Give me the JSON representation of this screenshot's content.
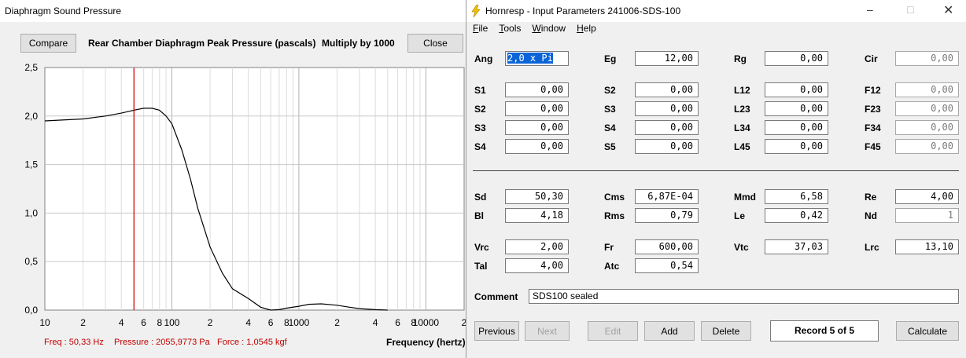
{
  "chart_window": {
    "title": "Diaphragm Sound Pressure",
    "compare_label": "Compare",
    "heading": "Rear Chamber Diaphragm Peak Pressure (pascals)",
    "multiplier": "Multiply by 1000",
    "close_label": "Close",
    "status": {
      "freq": "Freq : 50,33 Hz",
      "pressure": "Pressure : 2055,9773 Pa",
      "force": "Force : 1,0545 kgf"
    },
    "xaxis_title": "Frequency (hertz)"
  },
  "chart_data": {
    "type": "line",
    "title": "Rear Chamber Diaphragm Peak Pressure (pascals)",
    "xlabel": "Frequency (hertz)",
    "ylabel": "",
    "xscale": "log",
    "xlim": [
      10,
      20000
    ],
    "ylim": [
      0,
      2.5
    ],
    "grid": true,
    "yticks": [
      "0,0",
      "0,5",
      "1,0",
      "1,5",
      "2,0",
      "2,5"
    ],
    "xticks": [
      {
        "v": 10,
        "t": "10"
      },
      {
        "v": 20,
        "t": "2"
      },
      {
        "v": 40,
        "t": "4"
      },
      {
        "v": 60,
        "t": "6"
      },
      {
        "v": 80,
        "t": "8"
      },
      {
        "v": 100,
        "t": "100"
      },
      {
        "v": 200,
        "t": "2"
      },
      {
        "v": 400,
        "t": "4"
      },
      {
        "v": 600,
        "t": "6"
      },
      {
        "v": 800,
        "t": "8"
      },
      {
        "v": 1000,
        "t": "1000"
      },
      {
        "v": 2000,
        "t": "2"
      },
      {
        "v": 4000,
        "t": "4"
      },
      {
        "v": 6000,
        "t": "6"
      },
      {
        "v": 8000,
        "t": "8"
      },
      {
        "v": 10000,
        "t": "10000"
      },
      {
        "v": 20000,
        "t": "2"
      }
    ],
    "cursor_x": 50.33,
    "cursor_color": "#d00000",
    "series": [
      {
        "x": [
          10,
          20,
          30,
          40,
          50,
          60,
          70,
          80,
          90,
          100,
          120,
          140,
          160,
          200,
          250,
          300,
          400,
          500,
          600,
          700,
          800,
          1000,
          1200,
          1500,
          2000,
          2500,
          3000,
          4000,
          5000
        ],
        "y": [
          1.95,
          1.97,
          2.0,
          2.03,
          2.06,
          2.08,
          2.08,
          2.06,
          2.0,
          1.92,
          1.65,
          1.35,
          1.05,
          0.65,
          0.38,
          0.22,
          0.12,
          0.03,
          0.0,
          0.005,
          0.02,
          0.04,
          0.06,
          0.065,
          0.05,
          0.03,
          0.015,
          0.005,
          0.0
        ]
      }
    ]
  },
  "input_window": {
    "title": "Hornresp - Input Parameters   241006-SDS-100",
    "menu": [
      "File",
      "Tools",
      "Window",
      "Help"
    ],
    "params": [
      {
        "label": "Ang",
        "value": "2,0 x Pi"
      },
      {
        "label": "Eg",
        "value": "12,00"
      },
      {
        "label": "Rg",
        "value": "0,00"
      },
      {
        "label": "Cir",
        "value": "0,00"
      },
      {
        "label": "S1",
        "value": "0,00"
      },
      {
        "label": "S2",
        "value": "0,00"
      },
      {
        "label": "L12",
        "value": "0,00"
      },
      {
        "label": "F12",
        "value": "0,00"
      },
      {
        "label": "S2",
        "value": "0,00"
      },
      {
        "label": "S3",
        "value": "0,00"
      },
      {
        "label": "L23",
        "value": "0,00"
      },
      {
        "label": "F23",
        "value": "0,00"
      },
      {
        "label": "S3",
        "value": "0,00"
      },
      {
        "label": "S4",
        "value": "0,00"
      },
      {
        "label": "L34",
        "value": "0,00"
      },
      {
        "label": "F34",
        "value": "0,00"
      },
      {
        "label": "S4",
        "value": "0,00"
      },
      {
        "label": "S5",
        "value": "0,00"
      },
      {
        "label": "L45",
        "value": "0,00"
      },
      {
        "label": "F45",
        "value": "0,00"
      },
      {
        "label": "Sd",
        "value": "50,30"
      },
      {
        "label": "Cms",
        "value": "6,87E-04"
      },
      {
        "label": "Mmd",
        "value": "6,58"
      },
      {
        "label": "Re",
        "value": "4,00"
      },
      {
        "label": "Bl",
        "value": "4,18"
      },
      {
        "label": "Rms",
        "value": "0,79"
      },
      {
        "label": "Le",
        "value": "0,42"
      },
      {
        "label": "Nd",
        "value": "1"
      },
      {
        "label": "Vrc",
        "value": "2,00"
      },
      {
        "label": "Fr",
        "value": "600,00"
      },
      {
        "label": "Vtc",
        "value": "37,03"
      },
      {
        "label": "Lrc",
        "value": "13,10"
      },
      {
        "label": "Tal",
        "value": "4,00"
      },
      {
        "label": "Atc",
        "value": "0,54"
      }
    ],
    "comment_label": "Comment",
    "comment_value": "SDS100 sealed",
    "buttons": {
      "previous": "Previous",
      "next": "Next",
      "edit": "Edit",
      "add": "Add",
      "delete": "Delete",
      "calculate": "Calculate"
    },
    "record": "Record 5 of 5"
  },
  "colors": {
    "selection": "#0a64d8",
    "status_text": "#c00000",
    "separator": "#404040"
  }
}
